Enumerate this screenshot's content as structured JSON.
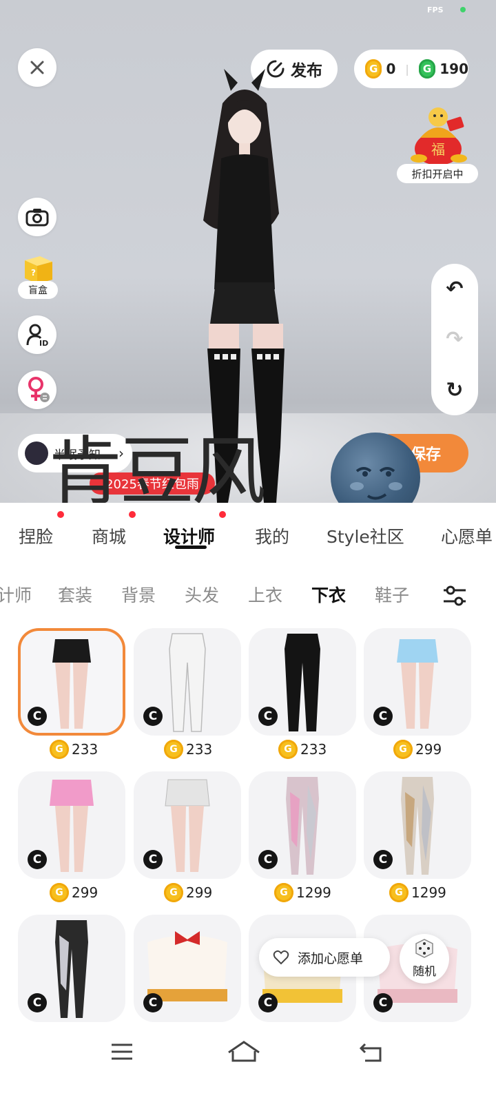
{
  "status": {
    "fps_label": "FPS"
  },
  "header": {
    "publish_label": "发布",
    "coins_gold": "0",
    "coins_green": "190",
    "promo_label": "折扣开启中"
  },
  "left_tools": {
    "blindbox_label": "盲盒",
    "user_name": "半眠予知"
  },
  "banner": {
    "label": "2025春节红包雨"
  },
  "save_label": "保存",
  "watermark_text": "肯豆风",
  "tabs": [
    {
      "label": "捏脸",
      "dot": true
    },
    {
      "label": "商城",
      "dot": true
    },
    {
      "label": "设计师",
      "dot": true,
      "active": true
    },
    {
      "label": "我的",
      "dot": false
    },
    {
      "label": "Style社区",
      "dot": false
    },
    {
      "label": "心愿单",
      "dot": false
    }
  ],
  "subtabs": [
    {
      "label": "计师"
    },
    {
      "label": "套装"
    },
    {
      "label": "背景"
    },
    {
      "label": "头发"
    },
    {
      "label": "上衣"
    },
    {
      "label": "下衣",
      "active": true
    },
    {
      "label": "鞋子"
    }
  ],
  "items": [
    {
      "price": "233",
      "type": "black-shorts",
      "selected": true
    },
    {
      "price": "233",
      "type": "white-pants"
    },
    {
      "price": "233",
      "type": "black-pants"
    },
    {
      "price": "299",
      "type": "blue-shorts"
    },
    {
      "price": "299",
      "type": "pink-shorts"
    },
    {
      "price": "299",
      "type": "white-shorts"
    },
    {
      "price": "1299",
      "type": "pink-silver-leggings"
    },
    {
      "price": "1299",
      "type": "gold-silver-leggings"
    },
    {
      "price": "",
      "type": "black-silver-leggings"
    },
    {
      "price": "",
      "type": "bloomers-red-bow"
    },
    {
      "price": "",
      "type": "bloomers-yellow"
    },
    {
      "price": "",
      "type": "bloomers-pink"
    }
  ],
  "wishlist_label": "添加心愿单",
  "random_label": "随机",
  "colors": {
    "accent_orange": "#f2893a",
    "red_banner": "#e8343a",
    "coin_gold": "#f7bf1e",
    "coin_green": "#34c25a"
  }
}
